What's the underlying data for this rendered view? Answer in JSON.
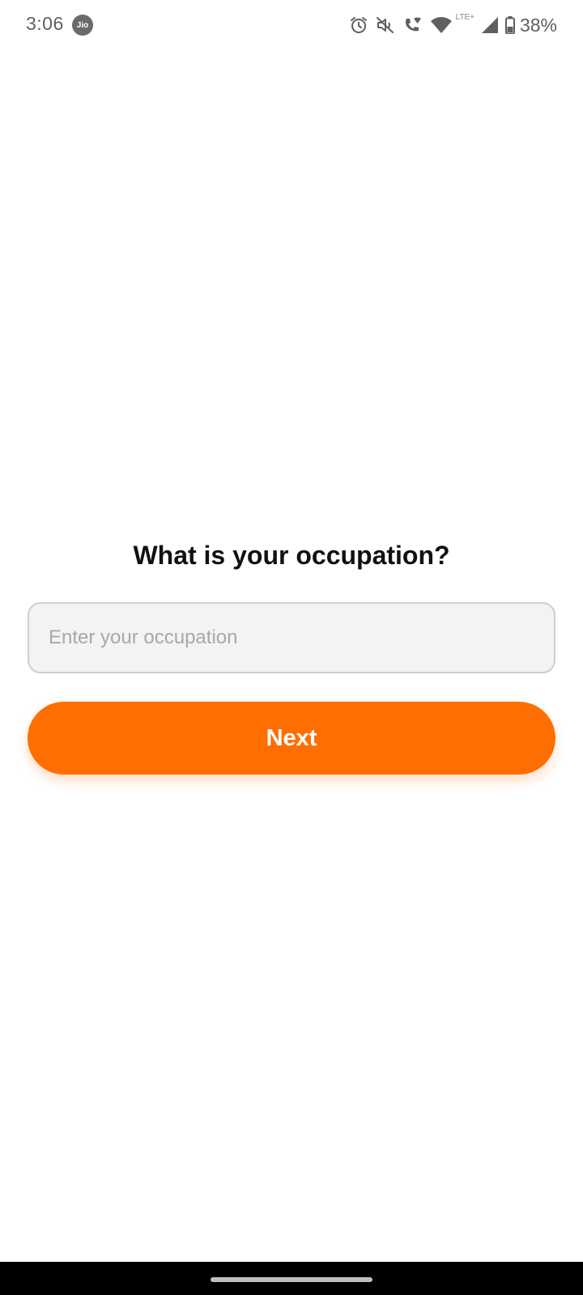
{
  "status_bar": {
    "time": "3:06",
    "carrier_badge": "Jio",
    "battery_percent": "38%",
    "network_label": "LTE+",
    "icons": [
      "alarm-icon",
      "mute-icon",
      "wifi-calling-icon",
      "wifi-icon",
      "signal-icon",
      "battery-icon"
    ]
  },
  "page": {
    "question": "What is your occupation?",
    "occupation_input": {
      "value": "",
      "placeholder": "Enter your occupation"
    },
    "next_label": "Next"
  },
  "colors": {
    "accent": "#ff6e00",
    "input_background": "#f3f3f3",
    "input_border": "#cfcfcf",
    "text_primary": "#111111",
    "placeholder": "#a8a8a8"
  }
}
